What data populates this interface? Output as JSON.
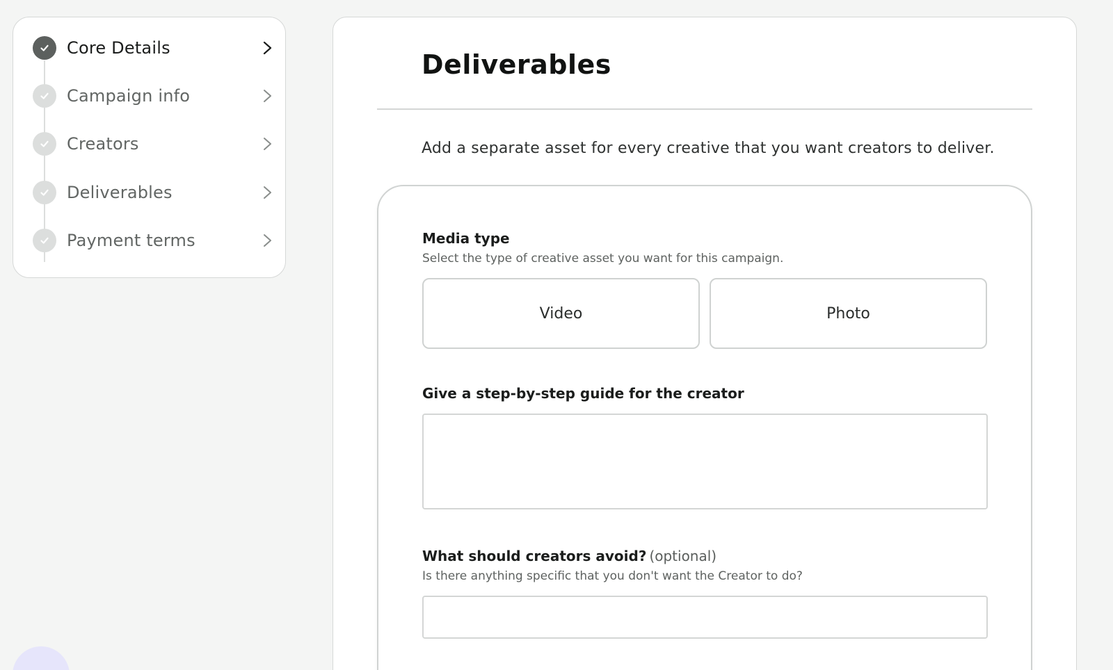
{
  "sidebar": {
    "steps": [
      {
        "label": "Core Details",
        "state": "active",
        "icon": "check-icon"
      },
      {
        "label": "Campaign info",
        "state": "complete",
        "icon": "check-icon"
      },
      {
        "label": "Creators",
        "state": "complete",
        "icon": "check-icon"
      },
      {
        "label": "Deliverables",
        "state": "complete",
        "icon": "check-icon"
      },
      {
        "label": "Payment terms",
        "state": "complete",
        "icon": "check-icon"
      }
    ],
    "chevron_icon": "chevron-right-icon"
  },
  "main": {
    "title": "Deliverables",
    "intro": "Add a separate asset for every creative that you want creators to deliver.",
    "asset": {
      "media_type": {
        "label": "Media type",
        "help": "Select the type of creative asset you want for this campaign.",
        "options": [
          "Video",
          "Photo"
        ]
      },
      "guide": {
        "label": "Give a step-by-step guide for the creator",
        "value": "",
        "placeholder": ""
      },
      "avoid": {
        "label": "What should creators avoid?",
        "optional": "(optional)",
        "help": "Is there anything specific that you don't want the Creator to do?",
        "value": "",
        "placeholder": ""
      }
    }
  },
  "colors": {
    "background": "#f4f5f4",
    "active_step": "#5c605e",
    "inactive_step": "#dcdedd",
    "help_bubble": "#e6e5fb"
  }
}
